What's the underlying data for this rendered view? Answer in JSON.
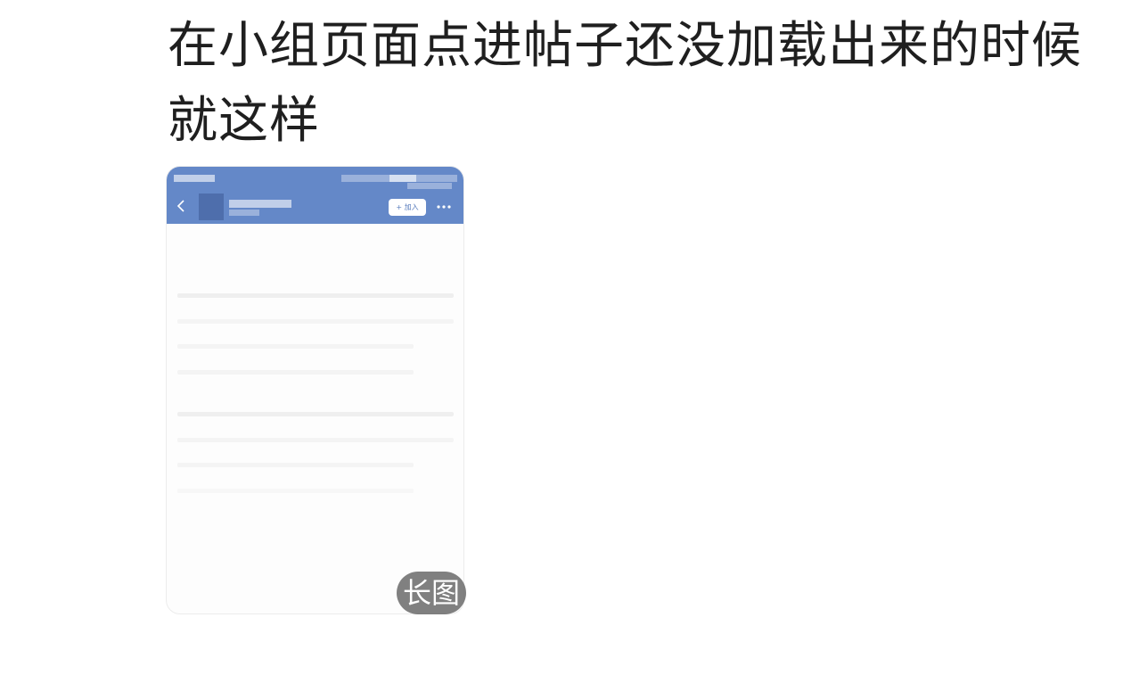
{
  "post": {
    "text": "在小组页面点进帖子还没加载出来的时候就这样"
  },
  "screenshot_thumb": {
    "header": {
      "join_label": "+ 加入",
      "back_icon": "chevron-left-icon",
      "more_icon": "more-dots-icon",
      "color": "#6488c8"
    },
    "badge_label": "长图"
  }
}
